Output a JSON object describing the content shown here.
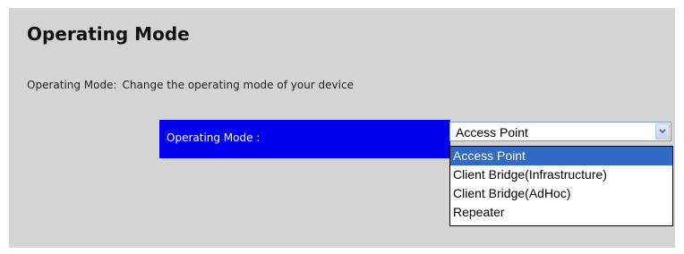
{
  "page": {
    "title": "Operating Mode",
    "description_label": "Operating Mode:",
    "description_text": "Change the operating mode of your device"
  },
  "form": {
    "field_label": "Operating Mode :",
    "select": {
      "value": "Access Point",
      "arrow_icon": "chevron-down-icon",
      "options": [
        "Access Point",
        "Client Bridge(Infrastructure)",
        "Client Bridge(AdHoc)",
        "Repeater"
      ],
      "highlighted_index": 0
    }
  },
  "colors": {
    "panel_background": "#d4d4d4",
    "label_background": "#0000ee",
    "highlight": "#316ac5"
  }
}
